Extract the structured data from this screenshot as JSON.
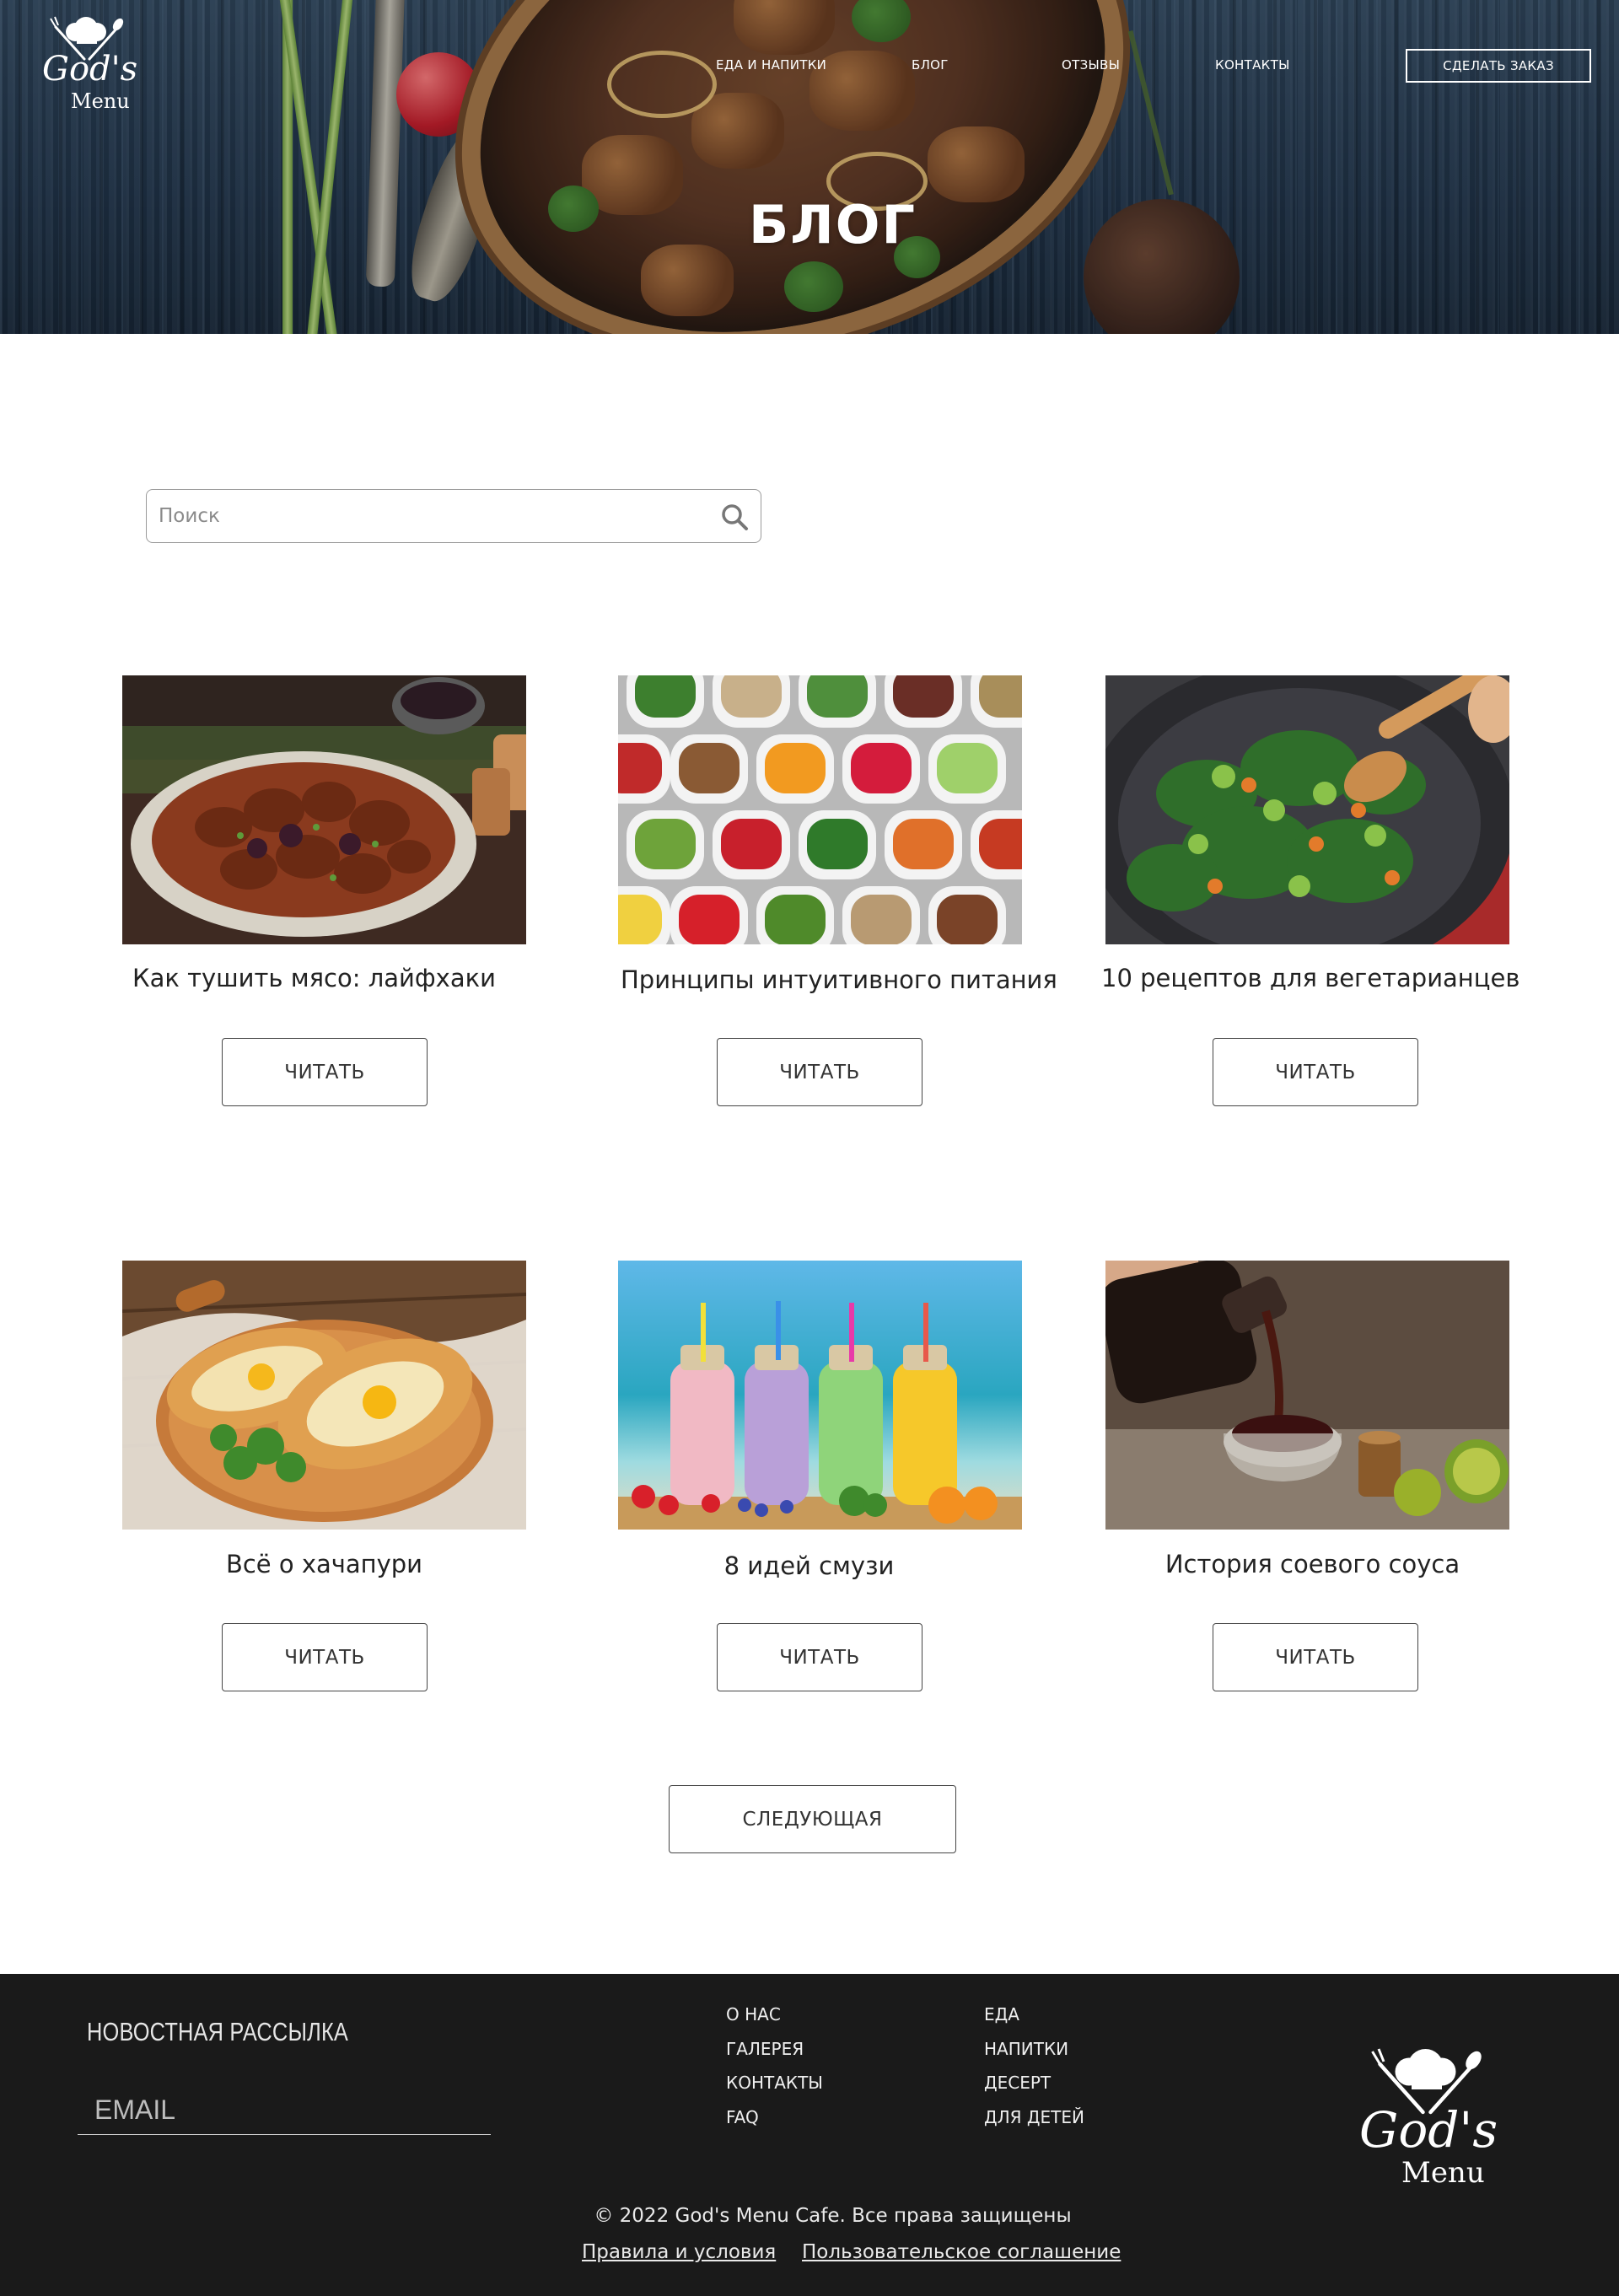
{
  "header": {
    "logo_line1": "God's",
    "logo_line2": "Menu",
    "nav": [
      "ЕДА И НАПИТКИ",
      "БЛОГ",
      "ОТЗЫВЫ",
      "КОНТАКТЫ"
    ],
    "order_button": "СДЕЛАТЬ ЗАКАЗ",
    "title": "БЛОГ"
  },
  "search": {
    "placeholder": "Поиск",
    "value": ""
  },
  "posts": [
    {
      "title": "Как тушить мясо: лайфхаки",
      "button": "ЧИТАТЬ",
      "image": "braised-meat-photo"
    },
    {
      "title": "Принципы интуитивного питания",
      "button": "ЧИТАТЬ",
      "image": "healthy-food-bowls-photo"
    },
    {
      "title": "10 рецептов для вегетарианцев",
      "button": "ЧИТАТЬ",
      "image": "vegetable-wok-photo"
    },
    {
      "title": "Всё о хачапури",
      "button": "ЧИТАТЬ",
      "image": "khachapuri-photo"
    },
    {
      "title": "8 идей смузи",
      "button": "ЧИТАТЬ",
      "image": "smoothie-bottles-photo"
    },
    {
      "title": "История соевого соуса",
      "button": "ЧИТАТЬ",
      "image": "soy-sauce-photo"
    }
  ],
  "pagination": {
    "next_button": "СЛЕДУЮЩАЯ"
  },
  "footer": {
    "newsletter_title": "НОВОСТНАЯ РАССЫЛКА",
    "email_placeholder": "EMAIL",
    "links_col1": [
      "О НАС",
      "ГАЛЕРЕЯ",
      "КОНТАКТЫ",
      "FAQ"
    ],
    "links_col2": [
      "ЕДА",
      "НАПИТКИ",
      "ДЕСЕРТ",
      "ДЛЯ ДЕТЕЙ"
    ],
    "logo_line1": "God's",
    "logo_line2": "Menu",
    "copyright": "© 2022 God's Menu Cafe. Все права защищены",
    "terms_link": "Правила и условия",
    "agreement_link": "Пользовательское соглашение"
  },
  "colors": {
    "footer_bg": "#1a1a1a",
    "hero_bg": "#22354a",
    "text": "#222222",
    "button_border": "#444444"
  },
  "icons": {
    "search": "magnifier-icon",
    "logo": "chef-hat-icon"
  }
}
